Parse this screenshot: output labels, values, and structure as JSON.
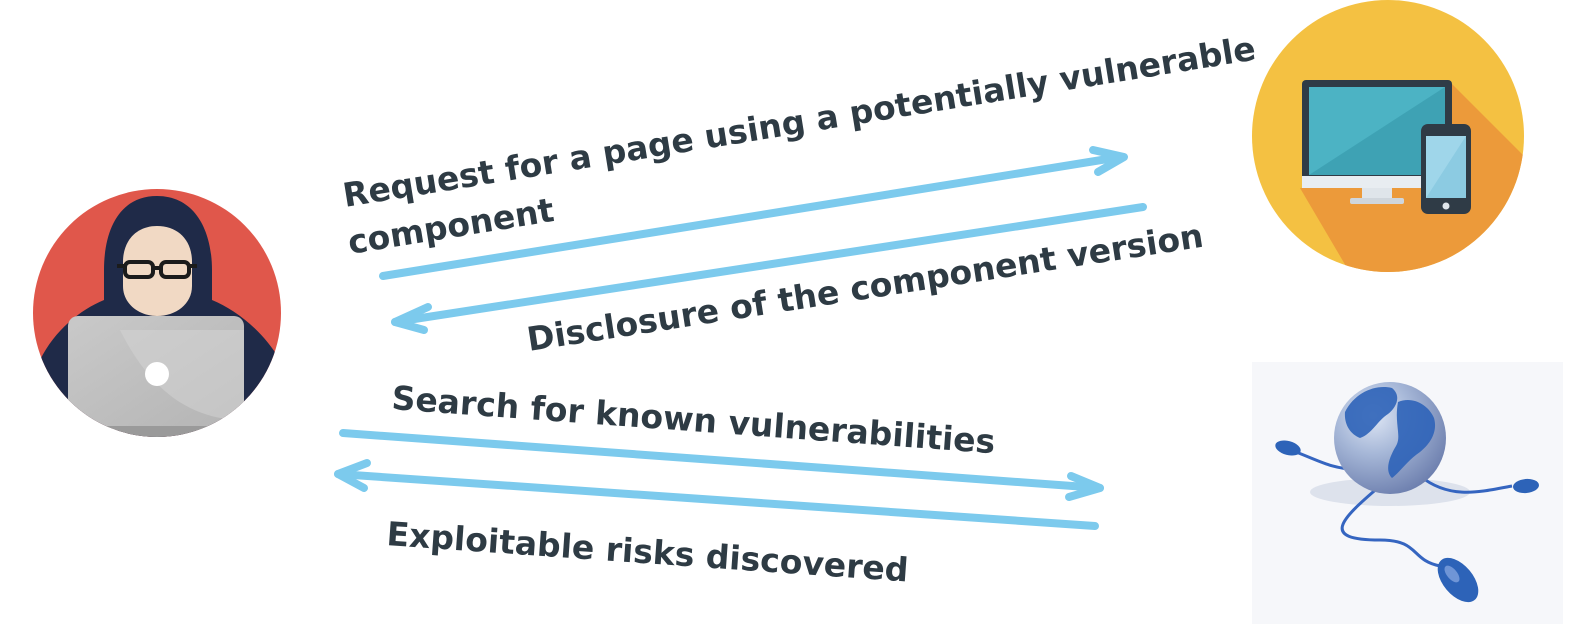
{
  "colors": {
    "arrow": "#7ccaed",
    "text": "#2e3b44",
    "attacker_circle": "#e0574b",
    "device_circle": "#f4c142",
    "device_shadow": "#ec9a3a",
    "monitor_screen": "#4cb3c4",
    "globe": "#2d63b8"
  },
  "actors": {
    "attacker": {
      "icon": "hooded-hacker-with-laptop-icon"
    },
    "target": {
      "icon": "desktop-and-phone-icon"
    },
    "internet": {
      "icon": "globe-with-mice-icon"
    }
  },
  "flows": {
    "request": {
      "line1": "Request for a page using a potentially vulnerable",
      "line2": "component"
    },
    "disclosure": {
      "text": "Disclosure of the component version"
    },
    "search": {
      "text": "Search for known vulnerabilities"
    },
    "exploit": {
      "text": "Exploitable risks discovered"
    }
  }
}
